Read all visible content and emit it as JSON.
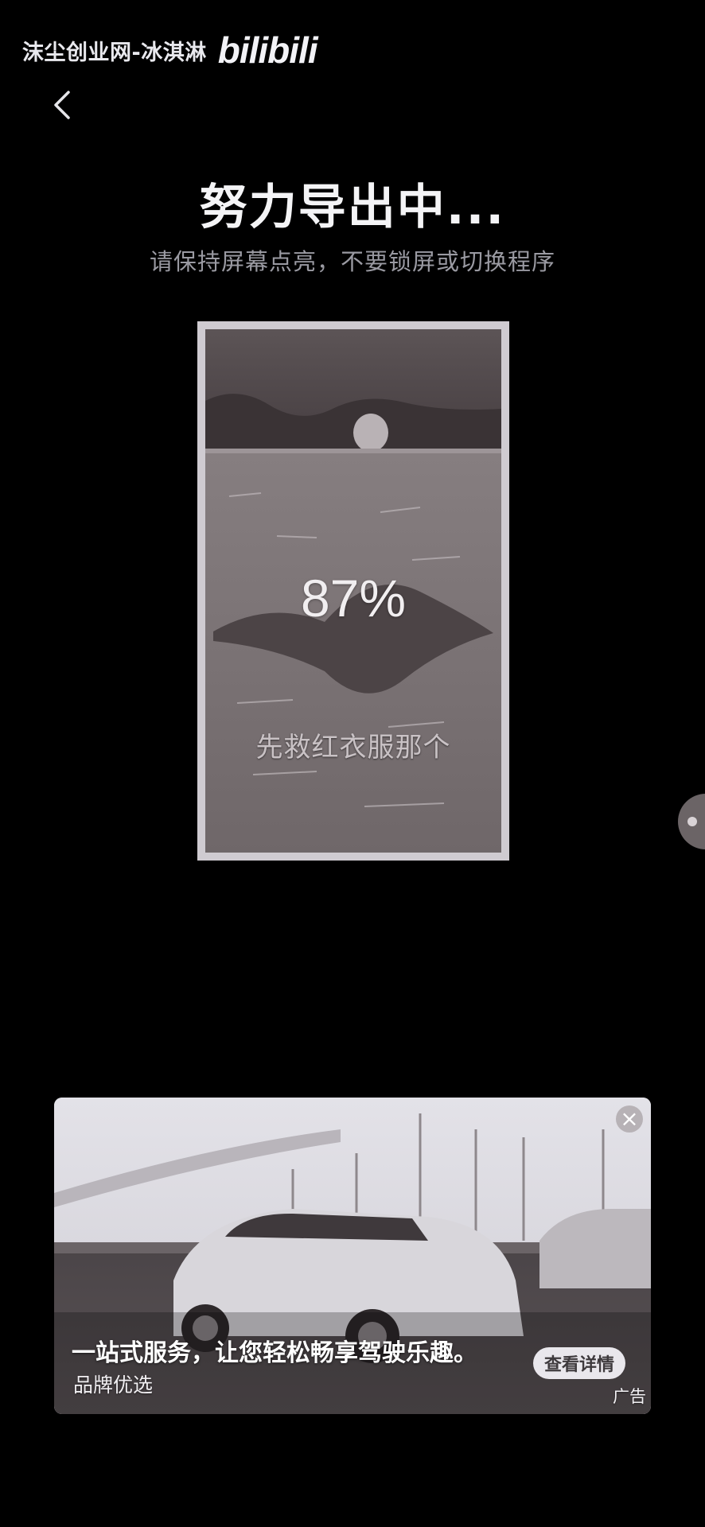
{
  "watermark": {
    "text": "沫尘创业网-冰淇淋",
    "logo": "bilibili"
  },
  "header": {
    "back_icon": "chevron-left-icon"
  },
  "export": {
    "title": "努力导出中...",
    "subtitle": "请保持屏幕点亮，不要锁屏或切换程序",
    "progress_label": "87%",
    "progress_value": 87,
    "preview_caption": "先救红衣服那个"
  },
  "ad": {
    "headline": "一站式服务，让您轻松畅享驾驶乐趣。",
    "brand": "品牌优选",
    "cta": "查看详情",
    "label": "广告",
    "close_icon": "close-icon"
  },
  "side_handle": {
    "icon": "floating-handle-icon"
  },
  "colors": {
    "background": "#000000",
    "title": "#f4f4f6",
    "subtitle": "#9a9aa2"
  }
}
